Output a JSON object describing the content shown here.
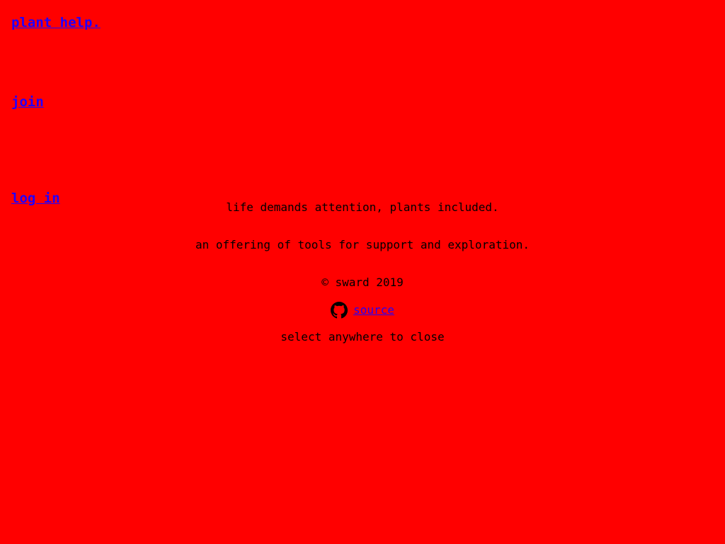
{
  "nav": {
    "brand": "plant help.",
    "join": "join",
    "login": "log in"
  },
  "about": {
    "tagline": "life demands attention, plants included.",
    "offering": "an offering of tools for support and exploration.",
    "copyright": "© sward 2019",
    "source_icon": "github-icon",
    "source_label": "source",
    "close_hint": "select anywhere to close"
  },
  "colors": {
    "background": "#ff0000",
    "link": "#2200ff",
    "text": "#000000"
  }
}
